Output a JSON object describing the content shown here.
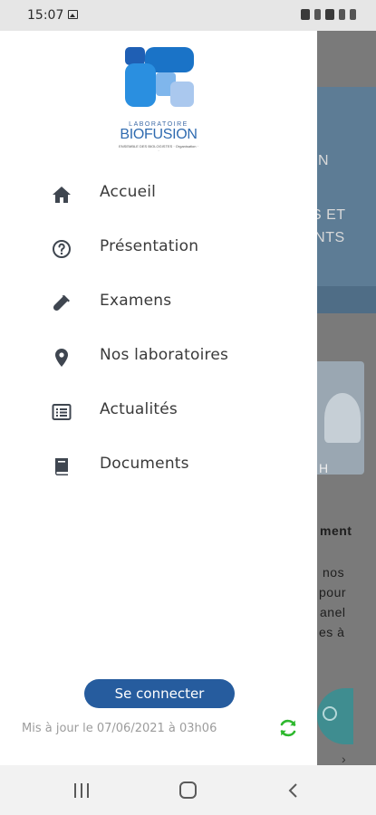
{
  "status_bar": {
    "time": "15:07"
  },
  "drawer": {
    "logo": {
      "top_text": "LABORATOIRE",
      "name": "BIOFUSION",
      "tagline": "ENSEMBLE DES BIOLOGISTES · Organisation · ·"
    },
    "menu": [
      {
        "label": "Accueil",
        "icon": "home-icon"
      },
      {
        "label": "Présentation",
        "icon": "question-circle-icon"
      },
      {
        "label": "Examens",
        "icon": "test-tube-icon"
      },
      {
        "label": "Nos laboratoires",
        "icon": "location-pin-icon"
      },
      {
        "label": "Actualités",
        "icon": "news-list-icon"
      },
      {
        "label": "Documents",
        "icon": "book-icon"
      }
    ],
    "connect_button": "Se connecter",
    "last_update": "Mis à jour le 07/06/2021 à 03h06",
    "refresh_icon": "refresh-icon"
  },
  "background": {
    "banner_line1": "N",
    "banner_line2": "S ET",
    "banner_line3": "ENTS",
    "photo_caption": "H",
    "section_title": "ment",
    "paragraph": [
      "nos",
      "pour",
      "anel",
      "es à"
    ]
  },
  "colors": {
    "accent": "#265c9e",
    "refresh": "#2eb82e",
    "logo_blue": "#1a73c7",
    "logo_light": "#aac8ee"
  }
}
